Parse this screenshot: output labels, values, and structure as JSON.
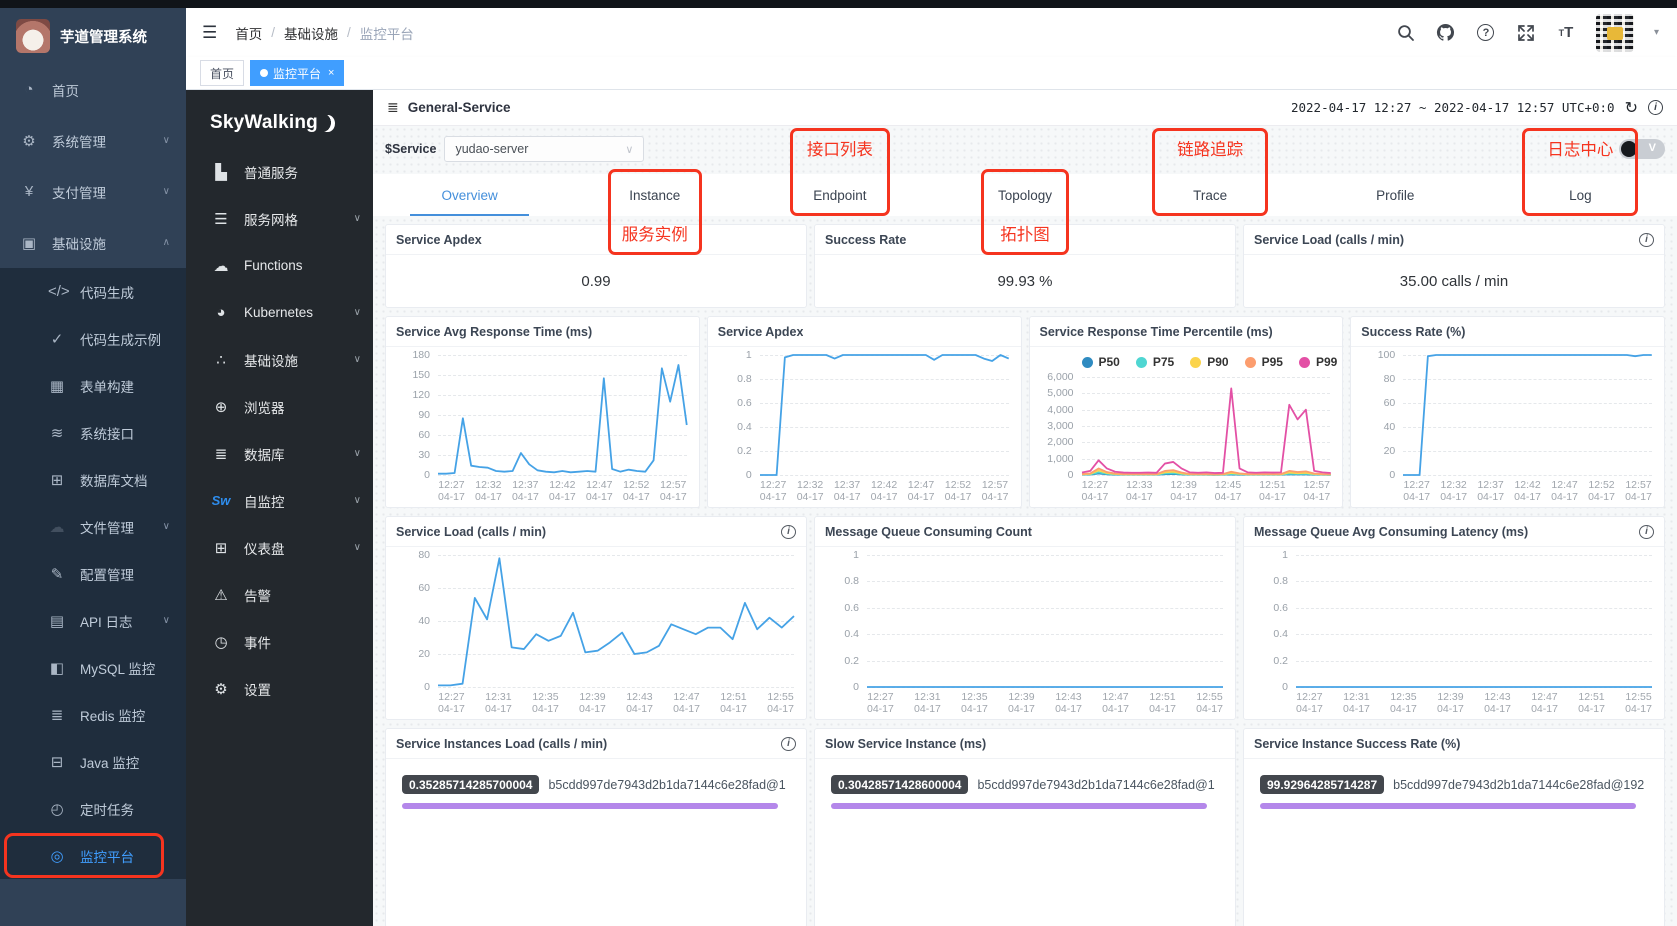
{
  "colors": {
    "accent": "#409eff",
    "red": "#f5341f",
    "sidebar": "#304156",
    "submenu": "#1f2d3d",
    "swside": "#23282d",
    "purple": "#b487ea",
    "chart_line": "#45a2e6"
  },
  "outer_sidebar": {
    "logo_title": "芋道管理系统",
    "items": [
      {
        "label": "首页",
        "icon": "dashboard-icon",
        "glyph": "◔"
      },
      {
        "label": "系统管理",
        "icon": "gear-icon",
        "glyph": "⚙",
        "chevron": "down"
      },
      {
        "label": "支付管理",
        "icon": "yuan-icon",
        "glyph": "¥",
        "chevron": "down"
      },
      {
        "label": "基础设施",
        "icon": "infrastructure-icon",
        "glyph": "▣",
        "chevron": "up"
      },
      {
        "label": "代码生成",
        "icon": "code-icon",
        "glyph": "</>",
        "sub": true
      },
      {
        "label": "代码生成示例",
        "icon": "shield-check-icon",
        "glyph": "✓",
        "sub": true
      },
      {
        "label": "表单构建",
        "icon": "form-build-icon",
        "glyph": "▦",
        "sub": true
      },
      {
        "label": "系统接口",
        "icon": "sliders-icon",
        "glyph": "≋",
        "sub": true
      },
      {
        "label": "数据库文档",
        "icon": "table-icon",
        "glyph": "⊞",
        "sub": true
      },
      {
        "label": "文件管理",
        "icon": "cloud-upload-icon",
        "glyph": "☁",
        "sub": true,
        "chevron": "down",
        "dim": true
      },
      {
        "label": "配置管理",
        "icon": "edit-icon",
        "glyph": "✎",
        "sub": true
      },
      {
        "label": "API 日志",
        "icon": "api-log-icon",
        "glyph": "▤",
        "sub": true,
        "chevron": "down"
      },
      {
        "label": "MySQL 监控",
        "icon": "mysql-monitor-icon",
        "glyph": "◧",
        "sub": true
      },
      {
        "label": "Redis 监控",
        "icon": "redis-monitor-icon",
        "glyph": "≣",
        "sub": true
      },
      {
        "label": "Java 监控",
        "icon": "java-monitor-icon",
        "glyph": "⊟",
        "sub": true
      },
      {
        "label": "定时任务",
        "icon": "schedule-icon",
        "glyph": "◴",
        "sub": true
      },
      {
        "label": "监控平台",
        "icon": "eye-icon",
        "glyph": "◎",
        "sub": true,
        "highlight": true,
        "boxed": true
      }
    ]
  },
  "topbar": {
    "breadcrumb": [
      "首页",
      "基础设施",
      "监控平台"
    ]
  },
  "tags": [
    {
      "label": "首页"
    },
    {
      "label": "监控平台",
      "active": true,
      "closable": true
    }
  ],
  "skywalking": {
    "logo": "SkyWalking",
    "items": [
      {
        "label": "普通服务",
        "icon": "bar-chart-icon",
        "glyph": "▙"
      },
      {
        "label": "服务网格",
        "icon": "mesh-icon",
        "glyph": "☰",
        "chevron": "down"
      },
      {
        "label": "Functions",
        "icon": "cloud-icon",
        "glyph": "☁"
      },
      {
        "label": "Kubernetes",
        "icon": "kubernetes-icon",
        "glyph": "◕",
        "chevron": "down"
      },
      {
        "label": "基础设施",
        "icon": "dots-icon",
        "glyph": "∴",
        "chevron": "down"
      },
      {
        "label": "浏览器",
        "icon": "globe-icon",
        "glyph": "⊕"
      },
      {
        "label": "数据库",
        "icon": "database-icon",
        "glyph": "≣",
        "chevron": "down"
      },
      {
        "label": "自监控",
        "icon": "skywalking-sw-icon",
        "glyph": "Sw",
        "blue": true,
        "chevron": "down"
      },
      {
        "label": "仪表盘",
        "icon": "dashboard-grid-icon",
        "glyph": "⊞",
        "chevron": "down"
      },
      {
        "label": "告警",
        "icon": "alarm-icon",
        "glyph": "⚠"
      },
      {
        "label": "事件",
        "icon": "event-clock-icon",
        "glyph": "◷"
      },
      {
        "label": "设置",
        "icon": "settings-gear-icon",
        "glyph": "⚙"
      }
    ]
  },
  "dashboard": {
    "title": "General-Service",
    "time_range": "2022-04-17 12:27 ~ 2022-04-17 12:57 UTC+0:0",
    "service_label": "$Service",
    "service_value": "yudao-server",
    "version_toggle_label": "V",
    "tabs": [
      {
        "label": "Overview",
        "active": true
      },
      {
        "label": "Instance",
        "anno": "服务实例",
        "anno_pos": "below"
      },
      {
        "label": "Endpoint",
        "anno": "接口列表",
        "anno_pos": "above"
      },
      {
        "label": "Topology",
        "anno": "拓扑图",
        "anno_pos": "below"
      },
      {
        "label": "Trace",
        "anno": "链路追踪",
        "anno_pos": "above"
      },
      {
        "label": "Profile"
      },
      {
        "label": "Log",
        "anno": "日志中心",
        "anno_pos": "above"
      }
    ],
    "stat_cards": [
      {
        "title": "Service Apdex",
        "value": "0.99"
      },
      {
        "title": "Success Rate",
        "value": "99.93 %"
      },
      {
        "title": "Service Load (calls / min)",
        "value": "35.00 calls / min",
        "info": true
      }
    ],
    "instance_cards": [
      {
        "title": "Service Instances Load (calls / min)",
        "info": true,
        "badge": "0.35285714285700004",
        "name": "b5cdd997de7943d2b1da7144c6e28fad@1"
      },
      {
        "title": "Slow Service Instance (ms)",
        "badge": "0.30428571428600004",
        "name": "b5cdd997de7943d2b1da7144c6e28fad@1"
      },
      {
        "title": "Service Instance Success Rate (%)",
        "badge": "99.92964285714287",
        "name": "b5cdd997de7943d2b1da7144c6e28fad@192"
      }
    ]
  },
  "chart_data": [
    {
      "id": "avg-response-time",
      "row": 2,
      "type": "line",
      "title": "Service Avg Response Time (ms)",
      "ylim": [
        0,
        180
      ],
      "yticks": [
        "180",
        "150",
        "120",
        "90",
        "60",
        "30",
        "0"
      ],
      "x_labels": [
        "12:27",
        "12:32",
        "12:37",
        "12:42",
        "12:47",
        "12:52",
        "12:57"
      ],
      "x_sub": "04-17",
      "grid": true,
      "series": [
        {
          "name": "avg-response-time",
          "color": "#45a2e6",
          "values": [
            2,
            2,
            3,
            85,
            14,
            12,
            11,
            6,
            5,
            6,
            33,
            16,
            7,
            5,
            4,
            6,
            4,
            5,
            6,
            5,
            145,
            9,
            5,
            8,
            6,
            5,
            22,
            160,
            110,
            165,
            75
          ]
        }
      ]
    },
    {
      "id": "service-apdex-chart",
      "row": 2,
      "type": "line",
      "title": "Service Apdex",
      "ylim": [
        0,
        1
      ],
      "yticks": [
        "1",
        "0.8",
        "0.6",
        "0.4",
        "0.2",
        "0"
      ],
      "x_labels": [
        "12:27",
        "12:32",
        "12:37",
        "12:42",
        "12:47",
        "12:52",
        "12:57"
      ],
      "x_sub": "04-17",
      "grid": true,
      "series": [
        {
          "name": "apdex",
          "color": "#45a2e6",
          "values": [
            0,
            0,
            0,
            0.98,
            1,
            1,
            1,
            1,
            1,
            0.97,
            1,
            1,
            1,
            1,
            1,
            1,
            1,
            1,
            1,
            1,
            1,
            0.96,
            1,
            1,
            1,
            1,
            1,
            0.97,
            0.95,
            1,
            0.97
          ]
        }
      ]
    },
    {
      "id": "response-time-percentile",
      "row": 2,
      "type": "line",
      "title": "Service Response Time Percentile (ms)",
      "ylim": [
        0,
        6000
      ],
      "yticks": [
        "6,000",
        "5,000",
        "4,000",
        "3,000",
        "2,000",
        "1,000",
        "0"
      ],
      "legend": [
        {
          "name": "P50",
          "color": "#2f8bc1"
        },
        {
          "name": "P75",
          "color": "#4fd6d2"
        },
        {
          "name": "P90",
          "color": "#fbd44c"
        },
        {
          "name": "P95",
          "color": "#fc9d6e"
        },
        {
          "name": "P99",
          "color": "#e350a5"
        }
      ],
      "x_labels": [
        "12:27",
        "12:33",
        "12:39",
        "12:45",
        "12:51",
        "12:57"
      ],
      "x_sub": "04-17",
      "grid": true,
      "series": [
        {
          "name": "P50",
          "color": "#2f8bc1",
          "values": [
            15,
            25,
            90,
            40,
            20,
            15,
            15,
            15,
            15,
            15,
            50,
            60,
            30,
            15,
            15,
            15,
            12,
            15,
            30,
            20,
            15,
            15,
            15,
            15,
            15,
            40,
            30,
            35,
            20,
            15,
            12
          ]
        },
        {
          "name": "P75",
          "color": "#4fd6d2",
          "values": [
            25,
            40,
            160,
            70,
            35,
            25,
            25,
            25,
            25,
            25,
            90,
            110,
            55,
            25,
            25,
            25,
            20,
            25,
            60,
            40,
            25,
            25,
            25,
            25,
            25,
            80,
            60,
            70,
            35,
            25,
            20
          ]
        },
        {
          "name": "P90",
          "color": "#fbd44c",
          "values": [
            40,
            70,
            280,
            120,
            60,
            40,
            40,
            40,
            40,
            40,
            160,
            200,
            100,
            40,
            40,
            40,
            35,
            40,
            120,
            70,
            40,
            40,
            40,
            40,
            40,
            150,
            110,
            130,
            60,
            40,
            35
          ]
        },
        {
          "name": "P95",
          "color": "#fc9d6e",
          "values": [
            60,
            100,
            400,
            180,
            90,
            60,
            60,
            60,
            60,
            60,
            250,
            300,
            150,
            60,
            60,
            60,
            50,
            60,
            200,
            100,
            60,
            60,
            60,
            60,
            60,
            250,
            180,
            220,
            90,
            60,
            50
          ]
        },
        {
          "name": "P99",
          "color": "#e350a5",
          "values": [
            150,
            250,
            900,
            400,
            200,
            150,
            140,
            140,
            150,
            140,
            700,
            800,
            400,
            160,
            140,
            160,
            120,
            140,
            5300,
            400,
            160,
            140,
            160,
            150,
            160,
            4300,
            3400,
            4000,
            250,
            160,
            120
          ]
        }
      ]
    },
    {
      "id": "success-rate-pct",
      "row": 2,
      "type": "line",
      "title": "Success Rate (%)",
      "ylim": [
        0,
        100
      ],
      "yticks": [
        "100",
        "80",
        "60",
        "40",
        "20",
        "0"
      ],
      "x_labels": [
        "12:27",
        "12:32",
        "12:37",
        "12:42",
        "12:47",
        "12:52",
        "12:57"
      ],
      "x_sub": "04-17",
      "grid": true,
      "series": [
        {
          "name": "success-rate",
          "color": "#45a2e6",
          "values": [
            0,
            0,
            0,
            99,
            100,
            100,
            100,
            100,
            100,
            100,
            100,
            100,
            100,
            100,
            100,
            100,
            100,
            100,
            100,
            100,
            100,
            100,
            100,
            100,
            100,
            100,
            100,
            100,
            99,
            100,
            100
          ]
        }
      ]
    },
    {
      "id": "service-load-chart",
      "row": 3,
      "type": "line",
      "title": "Service Load (calls / min)",
      "info": true,
      "ylim": [
        0,
        80
      ],
      "yticks": [
        "80",
        "60",
        "40",
        "20",
        "0"
      ],
      "x_labels": [
        "12:27",
        "12:31",
        "12:35",
        "12:39",
        "12:43",
        "12:47",
        "12:51",
        "12:55"
      ],
      "x_sub": "04-17",
      "grid": true,
      "series": [
        {
          "name": "service-load",
          "color": "#45a2e6",
          "values": [
            1,
            1,
            2,
            54,
            41,
            78,
            24,
            23,
            32,
            28,
            31,
            45,
            21,
            22,
            27,
            33,
            20,
            21,
            25,
            38,
            35,
            32,
            36,
            36,
            29,
            51,
            35,
            42,
            36,
            43
          ]
        }
      ]
    },
    {
      "id": "mq-consuming-count",
      "row": 3,
      "type": "line",
      "title": "Message Queue Consuming Count",
      "ylim": [
        0,
        1
      ],
      "yticks": [
        "1",
        "0.8",
        "0.6",
        "0.4",
        "0.2",
        "0"
      ],
      "x_labels": [
        "12:27",
        "12:31",
        "12:35",
        "12:39",
        "12:43",
        "12:47",
        "12:51",
        "12:55"
      ],
      "x_sub": "04-17",
      "grid": true,
      "series": [
        {
          "name": "mq-count",
          "color": "#45a2e6",
          "values": [
            0,
            0,
            0,
            0,
            0,
            0,
            0,
            0,
            0,
            0,
            0,
            0,
            0,
            0,
            0,
            0,
            0,
            0,
            0,
            0,
            0,
            0,
            0,
            0,
            0,
            0,
            0,
            0,
            0,
            0
          ]
        }
      ]
    },
    {
      "id": "mq-avg-latency",
      "row": 3,
      "type": "line",
      "title": "Message Queue Avg Consuming Latency (ms)",
      "info": true,
      "ylim": [
        0,
        1
      ],
      "yticks": [
        "1",
        "0.8",
        "0.6",
        "0.4",
        "0.2",
        "0"
      ],
      "x_labels": [
        "12:27",
        "12:31",
        "12:35",
        "12:39",
        "12:43",
        "12:47",
        "12:51",
        "12:55"
      ],
      "x_sub": "04-17",
      "grid": true,
      "series": [
        {
          "name": "mq-latency",
          "color": "#45a2e6",
          "values": [
            0,
            0,
            0,
            0,
            0,
            0,
            0,
            0,
            0,
            0,
            0,
            0,
            0,
            0,
            0,
            0,
            0,
            0,
            0,
            0,
            0,
            0,
            0,
            0,
            0,
            0,
            0,
            0,
            0,
            0
          ]
        }
      ]
    }
  ]
}
